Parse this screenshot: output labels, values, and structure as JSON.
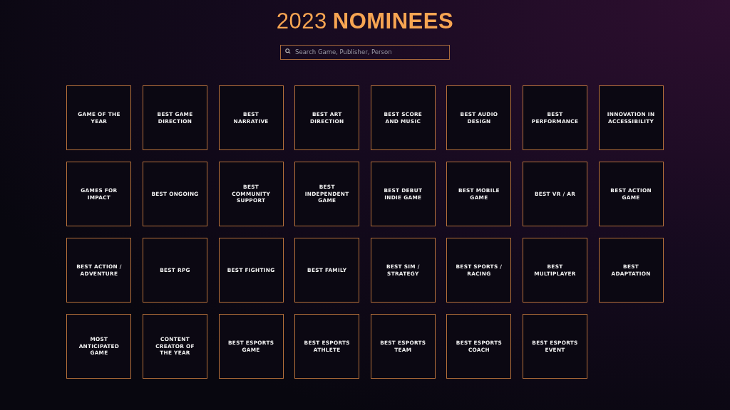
{
  "title": {
    "year": "2023",
    "word": "NOMINEES"
  },
  "search": {
    "placeholder": "Search Game, Publisher, Person"
  },
  "categories": [
    "GAME OF THE YEAR",
    "BEST GAME DIRECTION",
    "BEST NARRATIVE",
    "BEST ART DIRECTION",
    "BEST SCORE AND MUSIC",
    "BEST AUDIO DESIGN",
    "BEST PERFORMANCE",
    "INNOVATION IN ACCESSIBILITY",
    "GAMES FOR IMPACT",
    "BEST ONGOING",
    "BEST COMMUNITY SUPPORT",
    "BEST INDEPENDENT GAME",
    "BEST DEBUT INDIE GAME",
    "BEST MOBILE GAME",
    "BEST VR / AR",
    "BEST ACTION GAME",
    "BEST ACTION / ADVENTURE",
    "BEST RPG",
    "BEST FIGHTING",
    "BEST FAMILY",
    "BEST SIM / STRATEGY",
    "BEST SPORTS / RACING",
    "BEST MULTIPLAYER",
    "BEST ADAPTATION",
    "MOST ANTICIPATED GAME",
    "CONTENT CREATOR OF THE YEAR",
    "BEST ESPORTS GAME",
    "BEST ESPORTS ATHLETE",
    "BEST ESPORTS TEAM",
    "BEST ESPORTS COACH",
    "BEST ESPORTS EVENT"
  ]
}
